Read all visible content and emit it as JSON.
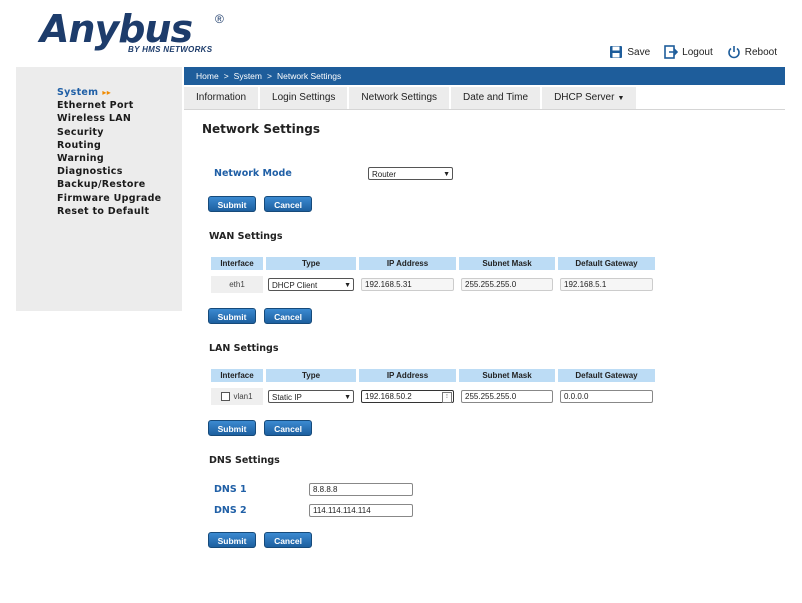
{
  "logo": {
    "main": "Anybus",
    "reg": "®",
    "sub": "BY HMS NETWORKS"
  },
  "top_actions": {
    "save": "Save",
    "logout": "Logout",
    "reboot": "Reboot"
  },
  "sidebar": {
    "items": [
      {
        "label": "System"
      },
      {
        "label": "Ethernet Port"
      },
      {
        "label": "Wireless LAN"
      },
      {
        "label": "Security"
      },
      {
        "label": "Routing"
      },
      {
        "label": "Warning"
      },
      {
        "label": "Diagnostics"
      },
      {
        "label": "Backup/Restore"
      },
      {
        "label": "Firmware Upgrade"
      },
      {
        "label": "Reset to Default"
      }
    ],
    "active_arrow": "▸▸"
  },
  "breadcrumb": {
    "home": "Home",
    "sep": ">",
    "system": "System",
    "page": "Network Settings"
  },
  "tabs": [
    "Information",
    "Login Settings",
    "Network Settings",
    "Date and Time",
    "DHCP Server"
  ],
  "page_title": "Network Settings",
  "network_mode": {
    "label": "Network Mode",
    "value": "Router"
  },
  "buttons": {
    "submit": "Submit",
    "cancel": "Cancel"
  },
  "table_headers": [
    "Interface",
    "Type",
    "IP Address",
    "Subnet Mask",
    "Default Gateway"
  ],
  "wan": {
    "title": "WAN Settings",
    "interface": "eth1",
    "type": "DHCP Client",
    "ip": "192.168.5.31",
    "mask": "255.255.255.0",
    "gateway": "192.168.5.1"
  },
  "lan": {
    "title": "LAN Settings",
    "interface": "vlan1",
    "type": "Static IP",
    "ip": "192.168.50.2",
    "mask": "255.255.255.0",
    "gateway": "0.0.0.0"
  },
  "dns": {
    "title": "DNS Settings",
    "dns1_label": "DNS 1",
    "dns1": "8.8.8.8",
    "dns2_label": "DNS 2",
    "dns2": "114.114.114.114"
  }
}
